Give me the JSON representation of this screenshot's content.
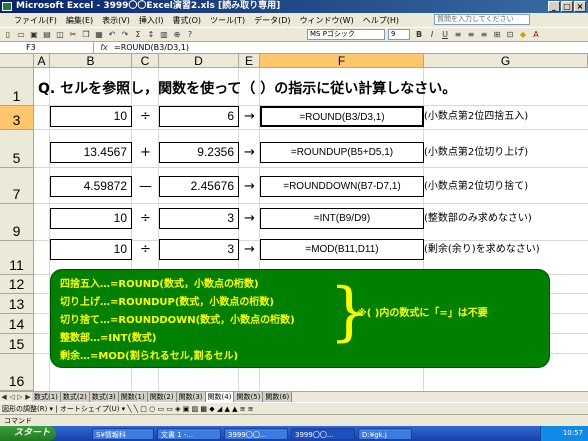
{
  "window": {
    "title": "Microsoft Excel - 3999〇〇Excel演習2.xls [読み取り専用]"
  },
  "menu": {
    "items": [
      "ファイル(F)",
      "編集(E)",
      "表示(V)",
      "挿入(I)",
      "書式(O)",
      "ツール(T)",
      "データ(D)",
      "ウィンドウ(W)",
      "ヘルプ(H)"
    ],
    "help_placeholder": "質問を入力してください"
  },
  "toolbar": {
    "font_name": "MS Pゴシック",
    "font_size": "9",
    "bold": "B",
    "italic": "I",
    "underline": "U"
  },
  "formula_bar": {
    "name_box": "F3",
    "fx": "fx",
    "formula": "=ROUND(B3/D3,1)"
  },
  "columns": [
    "A",
    "B",
    "C",
    "D",
    "E",
    "F",
    "G"
  ],
  "rows": [
    "1",
    "3",
    "5",
    "7",
    "9",
    "11",
    "12",
    "13",
    "14",
    "15",
    "16"
  ],
  "question": "Q. セルを参照し，関数を使って（ ）の指示に従い計算しなさい。",
  "problems": [
    {
      "b": "10",
      "op": "÷",
      "d": "6",
      "arrow": "→",
      "formula": "=ROUND(B3/D3,1)",
      "note": "(小数点第2位四捨五入)"
    },
    {
      "b": "13.4567",
      "op": "+",
      "d": "9.2356",
      "arrow": "→",
      "formula": "=ROUNDUP(B5+D5,1)",
      "note": "(小数点第2位切り上げ)"
    },
    {
      "b": "4.59872",
      "op": "—",
      "d": "2.45676",
      "arrow": "→",
      "formula": "=ROUNDDOWN(B7-D7,1)",
      "note": "(小数点第2位切り捨て)"
    },
    {
      "b": "10",
      "op": "÷",
      "d": "3",
      "arrow": "→",
      "formula": "=INT(B9/D9)",
      "note": "(整数部のみ求めなさい)"
    },
    {
      "b": "10",
      "op": "÷",
      "d": "3",
      "arrow": "→",
      "formula": "=MOD(B11,D11)",
      "note": "(剰余(余り)を求めなさい)"
    }
  ],
  "summary": {
    "lines": [
      "四捨五入…=ROUND(数式，小数点の桁数)",
      "切り上げ…=ROUNDUP(数式，小数点の桁数)",
      "切り捨て…=ROUNDDOWN(数式，小数点の桁数)",
      "整数部…=INT(数式)",
      "剰余…=MOD(割られるセル,割るセル)"
    ],
    "brace": "}",
    "note": "※( )内の数式に「=」は不要"
  },
  "sheet_tabs": [
    "数式(1)",
    "数式(2)",
    "数式(3)",
    "関数(1)",
    "関数(2)",
    "関数(3)",
    "関数(4)",
    "関数(5)",
    "関数(6)"
  ],
  "active_tab": "関数(4)",
  "drawing_toolbar": "図形の調整(R) ▾ | オートシェイプ(U) ▾ ╲ ╲ □ ○ ▭ ▭ ◈ ▣ ▨ ▩ ◆ ◢ ▲ ▲ ≡ ≡",
  "status": "コマンド",
  "taskbar": {
    "start": "スタート",
    "tasks": [
      "S¥情報科",
      "文書 1 -...",
      "3999〇〇...",
      "3999〇〇...",
      "D:¥gk.j"
    ],
    "active_task": 3,
    "tray": "10:57"
  }
}
